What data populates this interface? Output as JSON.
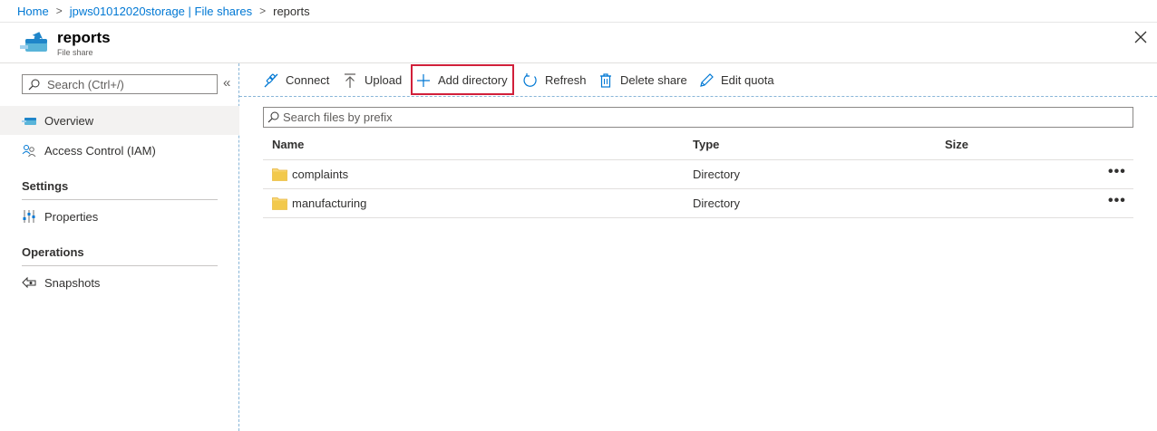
{
  "breadcrumb": {
    "home": "Home",
    "storage": "jpws01012020storage | File shares",
    "current": "reports",
    "separator": ">"
  },
  "header": {
    "title": "reports",
    "subtitle": "File share",
    "icon": "file-share-icon",
    "close_icon": "close-icon"
  },
  "leftnav": {
    "search_placeholder": "Search (Ctrl+/)",
    "collapse_label": "«",
    "items": [
      {
        "label": "Overview",
        "icon": "file-share-icon",
        "active": true
      },
      {
        "label": "Access Control (IAM)",
        "icon": "people-icon"
      }
    ],
    "sections": [
      {
        "title": "Settings",
        "items": [
          {
            "label": "Properties",
            "icon": "properties-icon"
          }
        ]
      },
      {
        "title": "Operations",
        "items": [
          {
            "label": "Snapshots",
            "icon": "snapshots-icon"
          }
        ]
      }
    ]
  },
  "toolbar": {
    "connect": "Connect",
    "upload": "Upload",
    "add_directory": "Add directory",
    "refresh": "Refresh",
    "delete_share": "Delete share",
    "edit_quota": "Edit quota"
  },
  "files": {
    "search_placeholder": "Search files by prefix",
    "columns": {
      "name": "Name",
      "type": "Type",
      "size": "Size"
    },
    "rows": [
      {
        "name": "complaints",
        "type": "Directory",
        "size": "",
        "more": "•••"
      },
      {
        "name": "manufacturing",
        "type": "Directory",
        "size": "",
        "more": "•••"
      }
    ]
  },
  "colors": {
    "accent": "#0078d4",
    "highlight": "#d1203a",
    "folder": "#f2c94c"
  }
}
